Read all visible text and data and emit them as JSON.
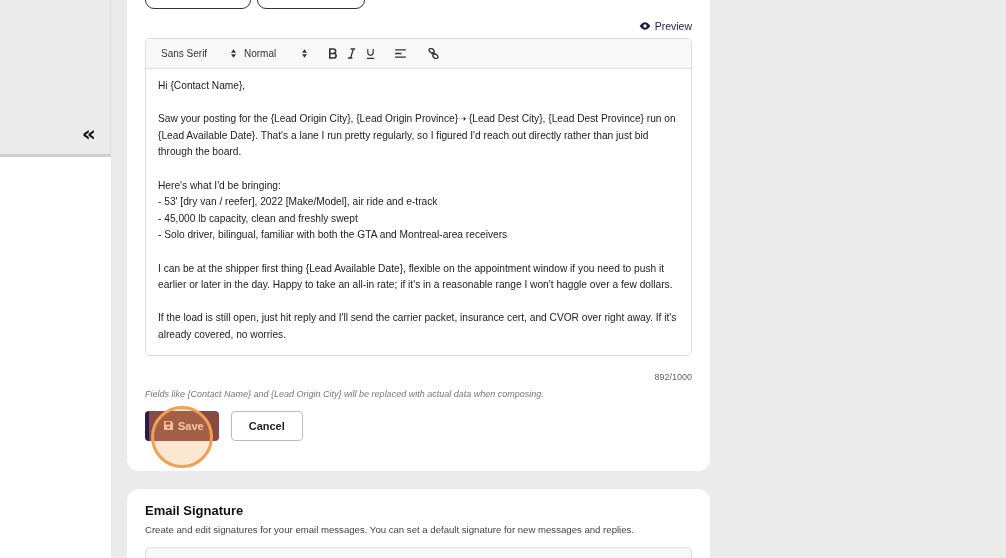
{
  "sidebar": {
    "collapse_icon": "«"
  },
  "preview_link": "Preview",
  "toolbar": {
    "font": "Sans Serif",
    "size": "Normal"
  },
  "editor": {
    "paragraphs": [
      [
        "Hi {Contact Name},"
      ],
      [
        "Saw your posting for the {Lead Origin City}, {Lead Origin Province}➝ {Lead Dest City}, {Lead Dest Province} run on {Lead Available Date}. That's a lane I run pretty regularly, so I figured I'd reach out directly rather than just bid through the board."
      ],
      [
        "Here's what I'd be bringing:",
        "- 53' [dry van / reefer], 2022 [Make/Model], air ride and e-track",
        "- 45,000 lb capacity, clean and freshly swept",
        "- Solo driver, bilingual, familiar with both the GTA and Montreal-area receivers"
      ],
      [
        "I can be at the shipper first thing {Lead Available Date}, flexible on the appointment window if you need to push it earlier or later in the day. Happy to take an all-in rate; if it's in a reasonable range I won't haggle over a few dollars."
      ],
      [
        "If the load is still open, just hit reply and I'll send the carrier packet, insurance cert, and CVOR over right away. If it's already covered, no worries."
      ]
    ]
  },
  "char_count": "892/1000",
  "hint": "Fields like {Contact Name} and {Lead Origin City} will be replaced with actual data when composing.",
  "buttons": [
    {
      "label": "Save",
      "kind": "primary",
      "highlighted": true
    },
    {
      "label": "Cancel",
      "kind": "secondary",
      "highlighted": false
    }
  ],
  "signature": {
    "title": "Email Signature",
    "description": "Create and edit signatures for your email messages. You can set a default signature for new messages and replies."
  }
}
